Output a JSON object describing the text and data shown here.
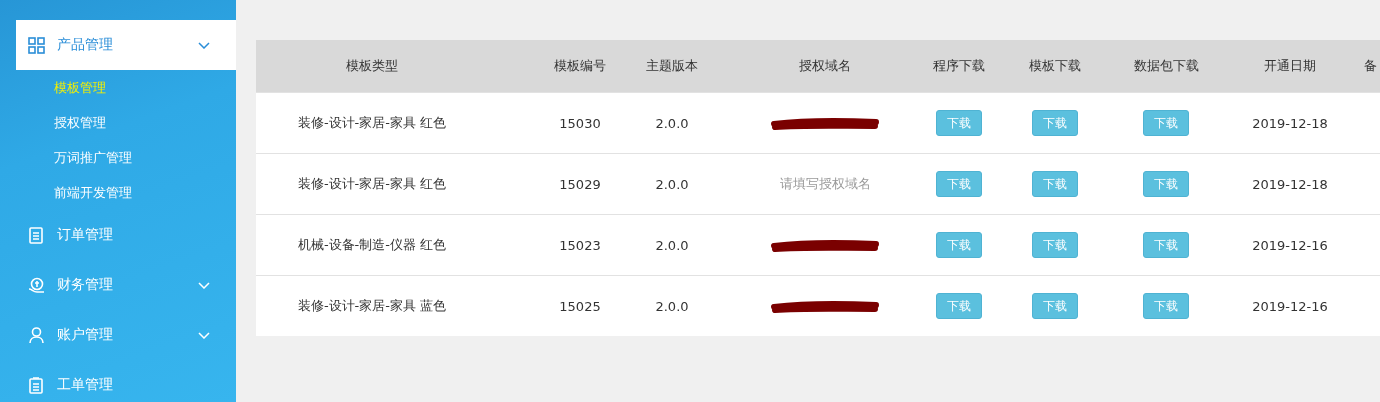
{
  "sidebar": {
    "items": [
      {
        "label": "产品管理",
        "selected": true,
        "expandable": true,
        "children": [
          {
            "label": "模板管理",
            "selected": true
          },
          {
            "label": "授权管理",
            "selected": false
          },
          {
            "label": "万词推广管理",
            "selected": false
          },
          {
            "label": "前端开发管理",
            "selected": false
          }
        ]
      },
      {
        "label": "订单管理",
        "selected": false,
        "expandable": false
      },
      {
        "label": "财务管理",
        "selected": false,
        "expandable": true
      },
      {
        "label": "账户管理",
        "selected": false,
        "expandable": true
      },
      {
        "label": "工单管理",
        "selected": false,
        "expandable": false
      }
    ]
  },
  "table": {
    "columns": [
      "模板类型",
      "模板编号",
      "主题版本",
      "授权域名",
      "程序下载",
      "模板下载",
      "数据包下载",
      "开通日期",
      "备"
    ],
    "rows": [
      {
        "type": "装修-设计-家居-家具 红色",
        "number": "15030",
        "version": "2.0.0",
        "domain": {
          "kind": "redacted"
        },
        "downloads": [
          "下载",
          "下载",
          "下载"
        ],
        "date": "2019-12-18"
      },
      {
        "type": "装修-设计-家居-家具 红色",
        "number": "15029",
        "version": "2.0.0",
        "domain": {
          "kind": "placeholder",
          "text": "请填写授权域名"
        },
        "downloads": [
          "下载",
          "下载",
          "下载"
        ],
        "date": "2019-12-18"
      },
      {
        "type": "机械-设备-制造-仪器 红色",
        "number": "15023",
        "version": "2.0.0",
        "domain": {
          "kind": "redacted"
        },
        "downloads": [
          "下载",
          "下载",
          "下载"
        ],
        "date": "2019-12-16"
      },
      {
        "type": "装修-设计-家居-家具 蓝色",
        "number": "15025",
        "version": "2.0.0",
        "domain": {
          "kind": "redacted"
        },
        "downloads": [
          "下载",
          "下载",
          "下载"
        ],
        "date": "2019-12-16"
      }
    ]
  }
}
